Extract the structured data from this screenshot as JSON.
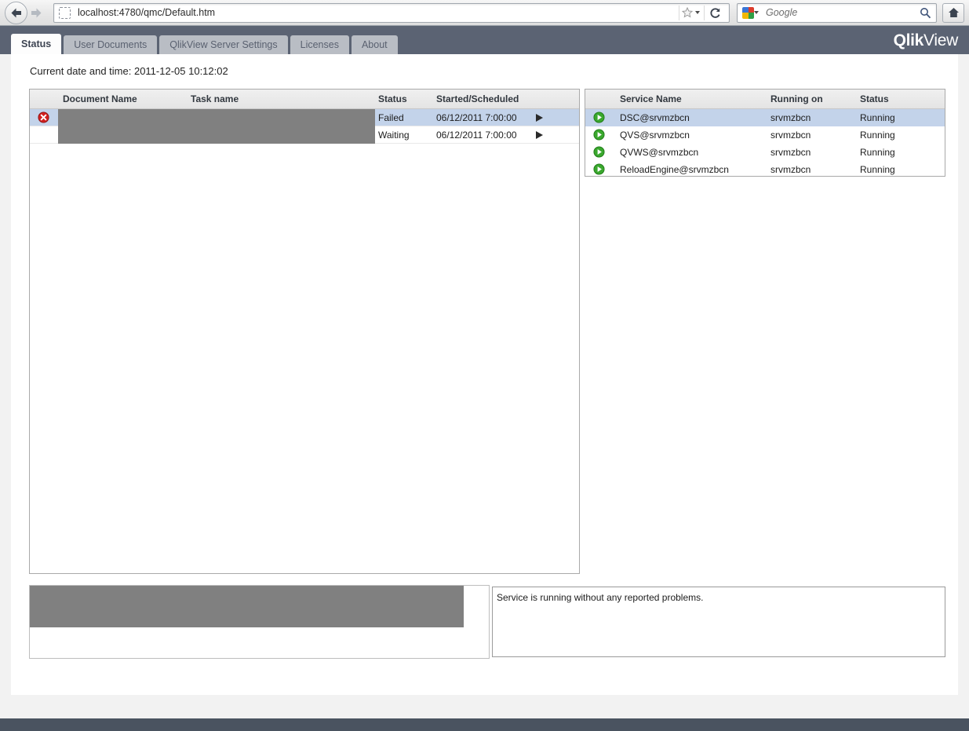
{
  "browser": {
    "back_icon": "back-arrow-icon",
    "forward_icon": "forward-arrow-icon",
    "page_icon": "page-placeholder-icon",
    "url": "localhost:4780/qmc/Default.htm",
    "bookmark_icon": "star-icon",
    "reload_icon": "reload-icon",
    "search_engine_icon": "google-favicon-icon",
    "search_placeholder": "Google",
    "search_icon": "magnifier-icon",
    "home_icon": "home-icon"
  },
  "header": {
    "logo_bold": "Qlik",
    "logo_regular": "View",
    "tabs": [
      {
        "label": "Status",
        "active": true
      },
      {
        "label": "User Documents",
        "active": false
      },
      {
        "label": "QlikView Server Settings",
        "active": false
      },
      {
        "label": "Licenses",
        "active": false
      },
      {
        "label": "About",
        "active": false
      }
    ]
  },
  "main": {
    "current_datetime_label": "Current date and time: 2011-12-05 10:12:02",
    "tasks": {
      "columns": [
        "Document Name",
        "Task name",
        "Status",
        "Started/Scheduled"
      ],
      "rows": [
        {
          "status_icon": "error-icon",
          "document_name": "",
          "task_name": "",
          "status": "Failed",
          "started_scheduled": "06/12/2011 7:00:00",
          "run_icon": "run-triangle-icon",
          "selected": true,
          "redacted": true
        },
        {
          "status_icon": "",
          "document_name": "",
          "task_name": "",
          "status": "Waiting",
          "started_scheduled": "06/12/2011 7:00:00",
          "run_icon": "run-triangle-icon",
          "selected": false,
          "redacted": true
        }
      ]
    },
    "services": {
      "columns": [
        "Service Name",
        "Running on",
        "Status"
      ],
      "rows": [
        {
          "state_icon": "play-running-icon",
          "service_name": "DSC@srvmzbcn",
          "running_on": "srvmzbcn",
          "status": "Running",
          "selected": true
        },
        {
          "state_icon": "play-running-icon",
          "service_name": "QVS@srvmzbcn",
          "running_on": "srvmzbcn",
          "status": "Running",
          "selected": false
        },
        {
          "state_icon": "play-running-icon",
          "service_name": "QVWS@srvmzbcn",
          "running_on": "srvmzbcn",
          "status": "Running",
          "selected": false
        },
        {
          "state_icon": "play-running-icon",
          "service_name": "ReloadEngine@srvmzbcn",
          "running_on": "srvmzbcn",
          "status": "Running",
          "selected": false
        }
      ]
    },
    "detail_panel": {
      "redacted": true,
      "text": ""
    },
    "log_panel": {
      "message": "Service is running without any reported problems."
    }
  },
  "colors": {
    "header_bg": "#5b6373",
    "selection": "#c3d3ea",
    "error_red": "#d22020",
    "running_green": "#3aa82e",
    "redaction_gray": "#808080"
  }
}
